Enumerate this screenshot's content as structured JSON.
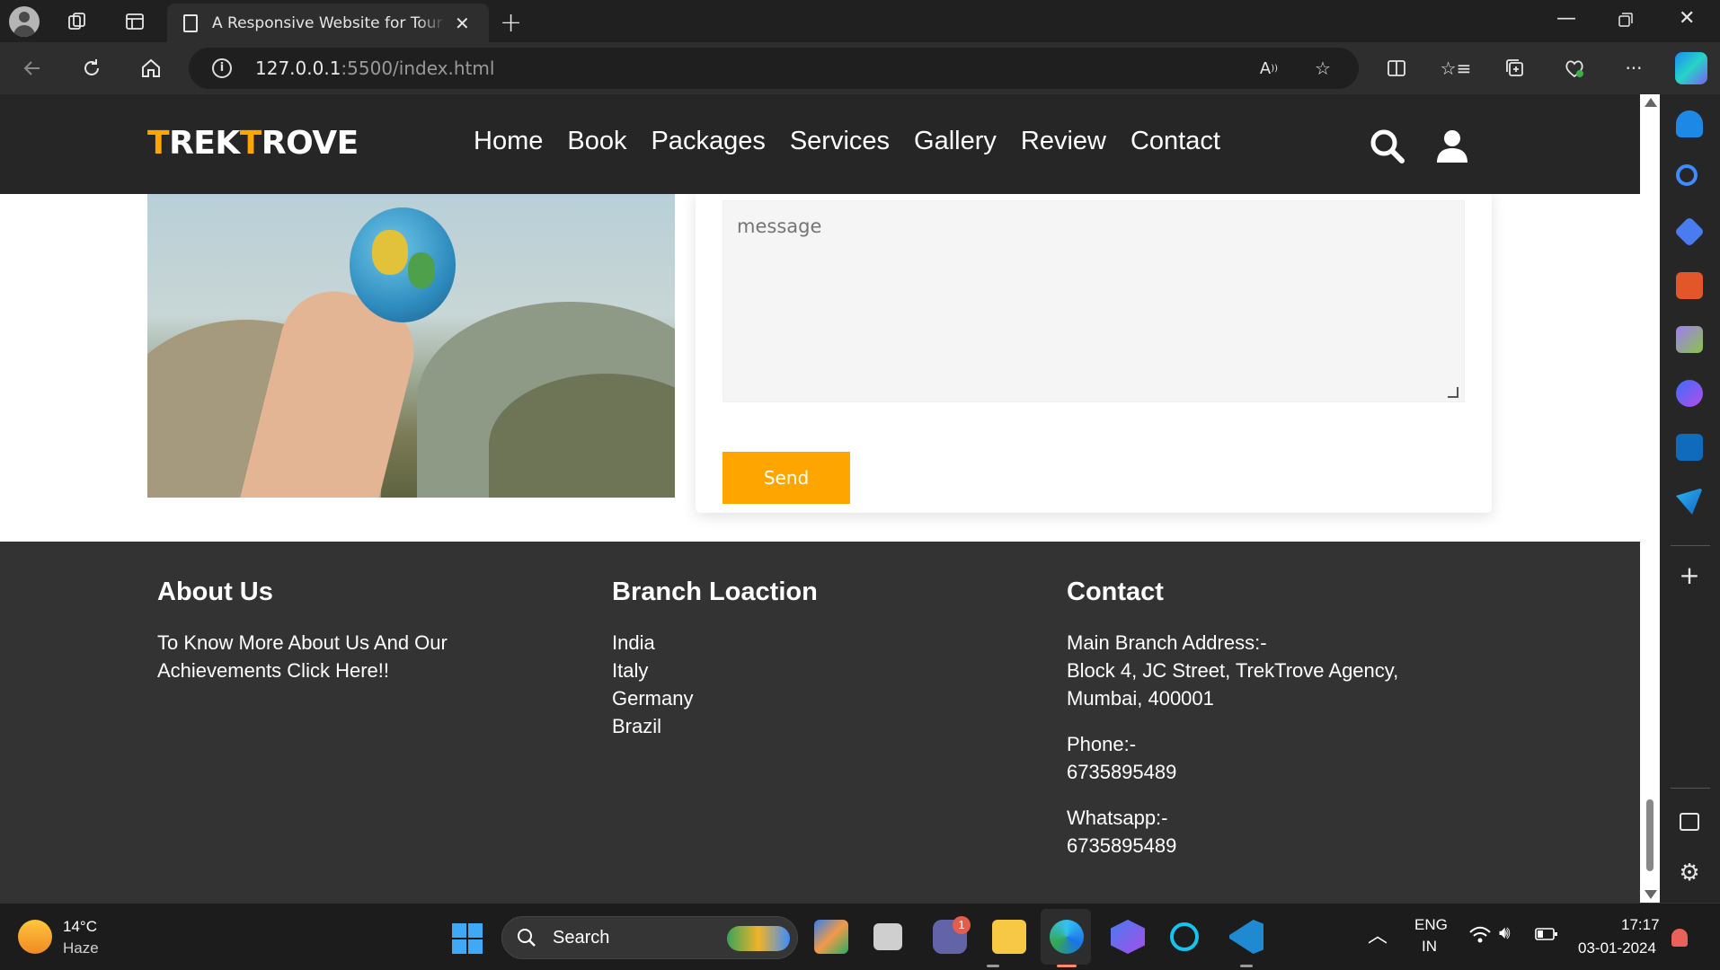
{
  "browser": {
    "tab_title": "A Responsive Website for Tour Ar",
    "url_host": "127.0.0.1",
    "url_rest": ":5500/index.html"
  },
  "site": {
    "logo_first": "T",
    "logo_mid": "REK",
    "logo_accent": "T",
    "logo_rest": "ROVE",
    "nav": [
      "Home",
      "Book",
      "Packages",
      "Services",
      "Gallery",
      "Review",
      "Contact"
    ],
    "accent_color": "#ffa500"
  },
  "form": {
    "message_placeholder": "message",
    "send_label": "Send"
  },
  "footer": {
    "about_title": "About Us",
    "about_text_1": "To Know More About Us And Our",
    "about_text_2": "Achievements Click Here!!",
    "branch_title": "Branch Loaction",
    "branches": [
      "India",
      "Italy",
      "Germany",
      "Brazil"
    ],
    "contact_title": "Contact",
    "address_label": "Main Branch Address:-",
    "address_line1": "Block 4, JC Street, TrekTrove Agency,",
    "address_line2": "Mumbai, 400001",
    "phone_label": "Phone:-",
    "phone": "6735895489",
    "whatsapp_label": "Whatsapp:-",
    "whatsapp": "6735895489"
  },
  "taskbar": {
    "temp": "14°C",
    "weather": "Haze",
    "search_label": "Search",
    "lang1": "ENG",
    "lang2": "IN",
    "time": "17:17",
    "date": "03-01-2024",
    "notification_count": "1"
  }
}
